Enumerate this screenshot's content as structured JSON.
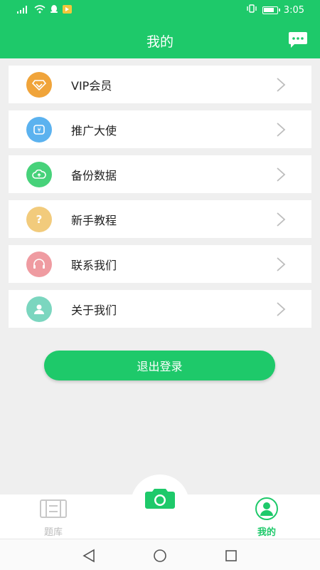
{
  "status_bar": {
    "time": "3:05"
  },
  "header": {
    "title": "我的",
    "message_icon": "message-icon"
  },
  "menu": [
    {
      "label": "VIP会员",
      "icon": "vip-diamond-icon",
      "color": "#f0a43a"
    },
    {
      "label": "推广大使",
      "icon": "share-icon",
      "color": "#5bb2ef"
    },
    {
      "label": "备份数据",
      "icon": "cloud-backup-icon",
      "color": "#47d27a"
    },
    {
      "label": "新手教程",
      "icon": "question-icon",
      "color": "#f2cb7c"
    },
    {
      "label": "联系我们",
      "icon": "headset-icon",
      "color": "#ef9ba1"
    },
    {
      "label": "关于我们",
      "icon": "person-icon",
      "color": "#7bd6bf"
    }
  ],
  "logout_label": "退出登录",
  "tabbar": {
    "left_label": "题库",
    "right_label": "我的",
    "center_icon": "camera-icon"
  },
  "colors": {
    "accent": "#1ec96a",
    "background": "#efefef"
  }
}
